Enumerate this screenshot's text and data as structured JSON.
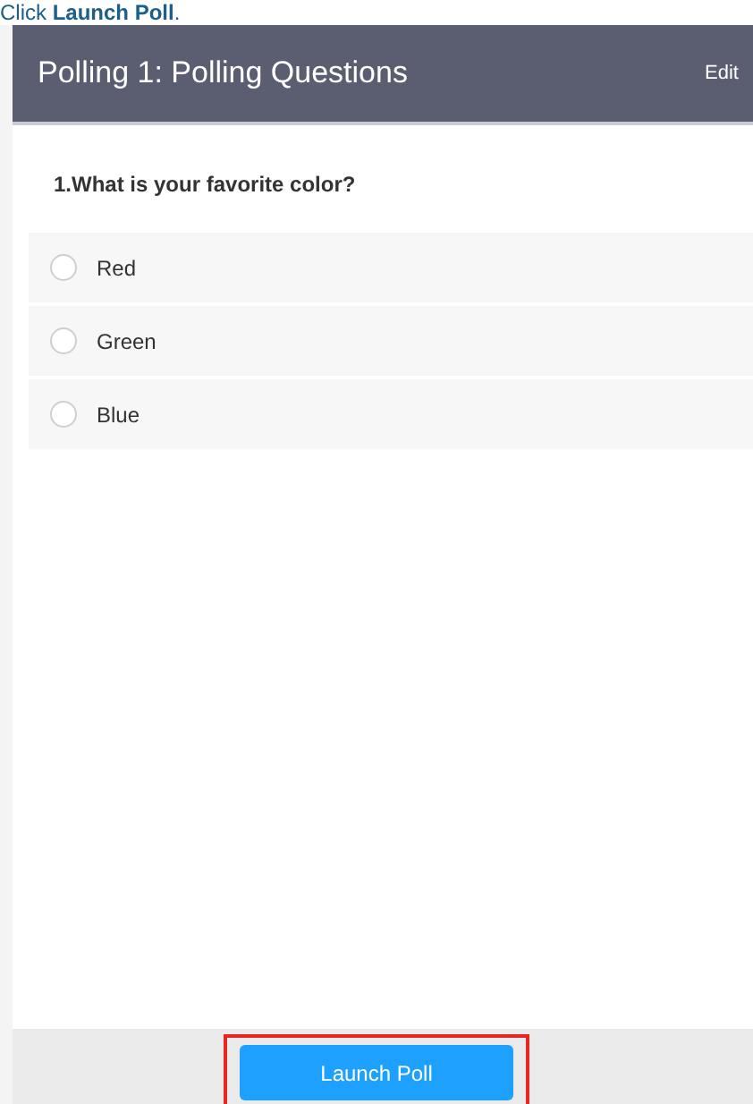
{
  "caption": "Click **Launch Poll**.",
  "header": {
    "title": "Polling 1: Polling Questions",
    "action": "Edit"
  },
  "question": "1.What is your favorite color?",
  "options": [
    {
      "label": "Red",
      "selected": false
    },
    {
      "label": "Green",
      "selected": false
    },
    {
      "label": "Blue",
      "selected": false
    }
  ],
  "footer": {
    "button": "Launch Poll",
    "highlighted": true
  }
}
